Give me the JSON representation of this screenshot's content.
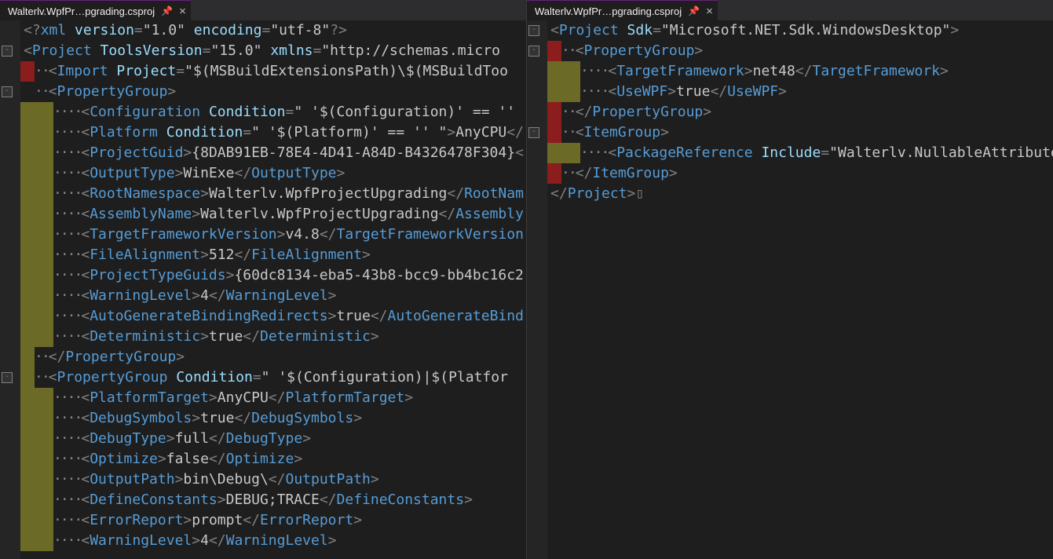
{
  "left": {
    "tab": "Walterlv.WpfPr…pgrading.csproj",
    "pin": "📌",
    "close": "×",
    "xml_decl": {
      "open": "<?",
      "tag": "xml",
      "a1": "version",
      "v1": "\"1.0\"",
      "a2": "encoding",
      "v2": "\"utf-8\"",
      "close": "?>"
    },
    "project": {
      "open": "<",
      "tag": "Project",
      "a1": "ToolsVersion",
      "v1": "\"15.0\"",
      "a2": "xmlns",
      "v2": "\"http://schemas.micro"
    },
    "import": {
      "open": "<",
      "tag": "Import",
      "a1": "Project",
      "v1": "\"$(MSBuildExtensionsPath)\\$(MSBuildToo"
    },
    "pg_open": {
      "open": "<",
      "tag": "PropertyGroup",
      "close": ">"
    },
    "cfg": {
      "open": "<",
      "tag": "Configuration",
      "a1": "Condition",
      "v1": "\" '$(Configuration)' == '' "
    },
    "plat": {
      "open": "<",
      "tag": "Platform",
      "a1": "Condition",
      "v1": "\" '$(Platform)' == '' \"",
      "close": ">",
      "tx": "AnyCPU",
      "cls": "</"
    },
    "guid": {
      "open": "<",
      "tag": "ProjectGuid",
      "close": ">",
      "tx": "{8DAB91EB-78E4-4D41-A84D-B4326478F304}",
      "cls": "<"
    },
    "outtype": {
      "open": "<",
      "tag": "OutputType",
      "close": ">",
      "tx": "WinExe",
      "cls_open": "</",
      "cls_tag": "OutputType",
      "cls_close": ">"
    },
    "rootns": {
      "open": "<",
      "tag": "RootNamespace",
      "close": ">",
      "tx": "Walterlv.WpfProjectUpgrading",
      "cls_open": "</",
      "cls_tag": "RootNam"
    },
    "asm": {
      "open": "<",
      "tag": "AssemblyName",
      "close": ">",
      "tx": "Walterlv.WpfProjectUpgrading",
      "cls_open": "</",
      "cls_tag": "Assembly"
    },
    "tfv": {
      "open": "<",
      "tag": "TargetFrameworkVersion",
      "close": ">",
      "tx": "v4.8",
      "cls_open": "</",
      "cls_tag": "TargetFrameworkVersion"
    },
    "falign": {
      "open": "<",
      "tag": "FileAlignment",
      "close": ">",
      "tx": "512",
      "cls_open": "</",
      "cls_tag": "FileAlignment",
      "cls_close": ">"
    },
    "ptg": {
      "open": "<",
      "tag": "ProjectTypeGuids",
      "close": ">",
      "tx": "{60dc8134-eba5-43b8-bcc9-bb4bc16c2"
    },
    "warn": {
      "open": "<",
      "tag": "WarningLevel",
      "close": ">",
      "tx": "4",
      "cls_open": "</",
      "cls_tag": "WarningLevel",
      "cls_close": ">"
    },
    "abr": {
      "open": "<",
      "tag": "AutoGenerateBindingRedirects",
      "close": ">",
      "tx": "true",
      "cls_open": "</",
      "cls_tag": "AutoGenerateBind"
    },
    "det": {
      "open": "<",
      "tag": "Deterministic",
      "close": ">",
      "tx": "true",
      "cls_open": "</",
      "cls_tag": "Deterministic",
      "cls_close": ">"
    },
    "pg_close": {
      "open": "</",
      "tag": "PropertyGroup",
      "close": ">"
    },
    "pg2": {
      "open": "<",
      "tag": "PropertyGroup",
      "a1": "Condition",
      "v1": "\" '$(Configuration)|$(Platfor"
    },
    "ptgt": {
      "open": "<",
      "tag": "PlatformTarget",
      "close": ">",
      "tx": "AnyCPU",
      "cls_open": "</",
      "cls_tag": "PlatformTarget",
      "cls_close": ">"
    },
    "dsym": {
      "open": "<",
      "tag": "DebugSymbols",
      "close": ">",
      "tx": "true",
      "cls_open": "</",
      "cls_tag": "DebugSymbols",
      "cls_close": ">"
    },
    "dtype": {
      "open": "<",
      "tag": "DebugType",
      "close": ">",
      "tx": "full",
      "cls_open": "</",
      "cls_tag": "DebugType",
      "cls_close": ">"
    },
    "opt": {
      "open": "<",
      "tag": "Optimize",
      "close": ">",
      "tx": "false",
      "cls_open": "</",
      "cls_tag": "Optimize",
      "cls_close": ">"
    },
    "opath": {
      "open": "<",
      "tag": "OutputPath",
      "close": ">",
      "tx": "bin\\Debug\\",
      "cls_open": "</",
      "cls_tag": "OutputPath",
      "cls_close": ">"
    },
    "defc": {
      "open": "<",
      "tag": "DefineConstants",
      "close": ">",
      "tx": "DEBUG;TRACE",
      "cls_open": "</",
      "cls_tag": "DefineConstants",
      "cls_close": ">"
    },
    "err": {
      "open": "<",
      "tag": "ErrorReport",
      "close": ">",
      "tx": "prompt",
      "cls_open": "</",
      "cls_tag": "ErrorReport",
      "cls_close": ">"
    },
    "warn2": {
      "open": "<",
      "tag": "WarningLevel",
      "close": ">",
      "tx": "4",
      "cls_open": "</",
      "cls_tag": "WarningLevel",
      "cls_close": ">"
    }
  },
  "right": {
    "tab": "Walterlv.WpfPr…pgrading.csproj",
    "pin": "📌",
    "close": "×",
    "project": {
      "open": "<",
      "tag": "Project",
      "a1": "Sdk",
      "v1": "\"Microsoft.NET.Sdk.WindowsDesktop\"",
      "close": ">"
    },
    "pg_open": {
      "open": "<",
      "tag": "PropertyGroup",
      "close": ">"
    },
    "tf": {
      "open": "<",
      "tag": "TargetFramework",
      "close": ">",
      "tx": "net48",
      "cls_open": "</",
      "cls_tag": "TargetFramework",
      "cls_close": ">"
    },
    "wpf": {
      "open": "<",
      "tag": "UseWPF",
      "close": ">",
      "tx": "true",
      "cls_open": "</",
      "cls_tag": "UseWPF",
      "cls_close": ">"
    },
    "pg_close": {
      "open": "</",
      "tag": "PropertyGroup",
      "close": ">"
    },
    "ig_open": {
      "open": "<",
      "tag": "ItemGroup",
      "close": ">"
    },
    "pkg": {
      "open": "<",
      "tag": "PackageReference",
      "a1": "Include",
      "v1": "\"Walterlv.NullableAttributes\""
    },
    "ig_close": {
      "open": "</",
      "tag": "ItemGroup",
      "close": ">"
    },
    "prj_close": {
      "open": "</",
      "tag": "Project",
      "close": ">"
    }
  },
  "dot2": "··",
  "dot4": "····",
  "dot6": "······"
}
